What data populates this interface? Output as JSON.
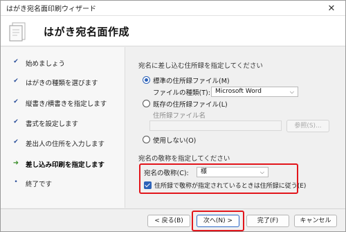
{
  "window": {
    "title": "はがき宛名面印刷ウィザード"
  },
  "header": {
    "title": "はがき宛名面作成"
  },
  "steps": [
    {
      "label": "始めましょう",
      "mark": "✔"
    },
    {
      "label": "はがきの種類を選びます",
      "mark": "✔"
    },
    {
      "label": "縦書き/横書きを指定します",
      "mark": "✔"
    },
    {
      "label": "書式を設定します",
      "mark": "✔"
    },
    {
      "label": "差出人の住所を入力します",
      "mark": "✔"
    },
    {
      "label": "差し込み印刷を指定します",
      "mark": "➜"
    },
    {
      "label": "終了です",
      "mark": "•"
    }
  ],
  "address_book": {
    "section_title": "宛名に差し込む住所録を指定してください",
    "standard_label": "標準の住所録ファイル(M)",
    "file_type_label": "ファイルの種類(T):",
    "file_type_value": "Microsoft Word",
    "existing_label": "既存の住所録ファイル(L)",
    "file_name_label": "住所録ファイル名",
    "browse_label": "参照(S)...",
    "none_label": "使用しない(O)"
  },
  "honorific": {
    "section_title": "宛名の敬称を指定してください",
    "label": "宛名の敬称(C):",
    "value": "様",
    "checkbox_label": "住所録で敬称が指定されているときは住所録に従う(E)"
  },
  "buttons": {
    "back": "< 戻る(B)",
    "next": "次へ(N) >",
    "finish": "完了(F)",
    "cancel": "キャンセル"
  },
  "colors": {
    "accent": "#2c62b8",
    "highlight": "#e2151b",
    "current_step": "#3a8f2a"
  }
}
